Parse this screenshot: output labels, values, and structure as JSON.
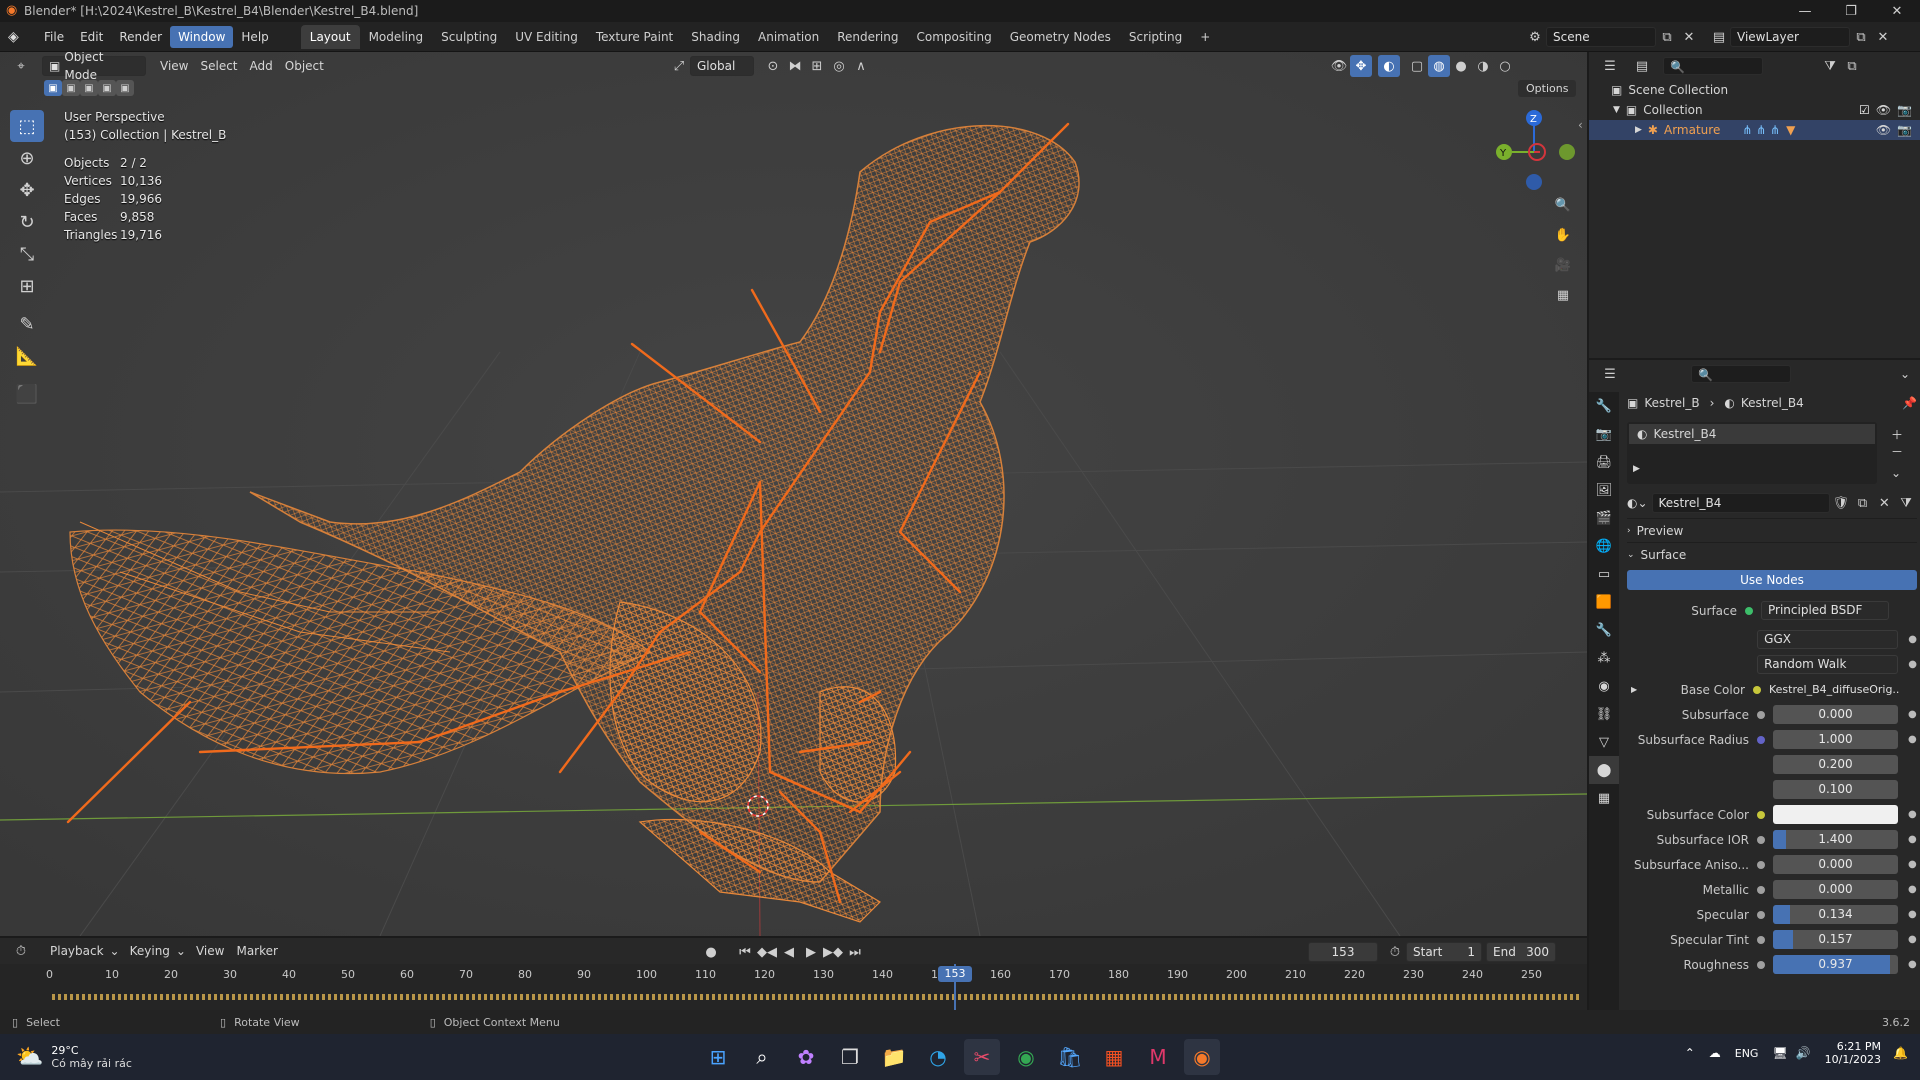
{
  "window": {
    "title": "Blender* [H:\\2024\\Kestrel_B\\Kestrel_B4\\Blender\\Kestrel_B4.blend]",
    "version": "3.6.2"
  },
  "menubar": {
    "menus": [
      "File",
      "Edit",
      "Render",
      "Window",
      "Help"
    ],
    "active_menu": "Window",
    "workspaces": [
      "Layout",
      "Modeling",
      "Sculpting",
      "UV Editing",
      "Texture Paint",
      "Shading",
      "Animation",
      "Rendering",
      "Compositing",
      "Geometry Nodes",
      "Scripting"
    ],
    "active_workspace": "Layout",
    "add_workspace": "+",
    "scene": "Scene",
    "view_layer": "ViewLayer"
  },
  "viewport": {
    "mode": "Object Mode",
    "menus": [
      "View",
      "Select",
      "Add",
      "Object"
    ],
    "orientation": "Global",
    "options_label": "Options",
    "overlay_title": "User Perspective",
    "overlay_subtitle": "(153) Collection | Kestrel_B",
    "stats": [
      {
        "label": "Objects",
        "value": "2 / 2"
      },
      {
        "label": "Vertices",
        "value": "10,136"
      },
      {
        "label": "Edges",
        "value": "19,966"
      },
      {
        "label": "Faces",
        "value": "9,858"
      },
      {
        "label": "Triangles",
        "value": "19,716"
      }
    ],
    "gizmo": {
      "z": "Z",
      "y": "Y"
    }
  },
  "outliner": {
    "scene_collection": "Scene Collection",
    "collection": "Collection",
    "armature": "Armature"
  },
  "properties": {
    "breadcrumb": [
      "Kestrel_B",
      "Kestrel_B4"
    ],
    "material_slot": "Kestrel_B4",
    "material_name": "Kestrel_B4",
    "panels": {
      "preview": "Preview",
      "surface": "Surface"
    },
    "use_nodes": "Use Nodes",
    "surface_label": "Surface",
    "surface_value": "Principled BSDF",
    "distribution": "GGX",
    "subsurface_method": "Random Walk",
    "base_color_label": "Base Color",
    "base_color_value": "Kestrel_B4_diffuseOrig...",
    "fields": [
      {
        "label": "Subsurface",
        "value": "0.000",
        "fill": 0
      },
      {
        "label": "Subsurface Radius",
        "value": "1.000",
        "fill": 0
      },
      {
        "label": "",
        "value": "0.200",
        "fill": 0
      },
      {
        "label": "",
        "value": "0.100",
        "fill": 0
      }
    ],
    "subsurface_color_label": "Subsurface Color",
    "fields2": [
      {
        "label": "Subsurface IOR",
        "value": "1.400",
        "fill": 0.1
      },
      {
        "label": "Subsurface Aniso...",
        "value": "0.000",
        "fill": 0
      },
      {
        "label": "Metallic",
        "value": "0.000",
        "fill": 0
      },
      {
        "label": "Specular",
        "value": "0.134",
        "fill": 0.134
      },
      {
        "label": "Specular Tint",
        "value": "0.157",
        "fill": 0.157
      },
      {
        "label": "Roughness",
        "value": "0.937",
        "fill": 0.937
      }
    ]
  },
  "timeline": {
    "menus": [
      "Playback",
      "Keying",
      "View",
      "Marker"
    ],
    "current_frame": "153",
    "start_label": "Start",
    "start_value": "1",
    "end_label": "End",
    "end_value": "300",
    "ticks": [
      "0",
      "10",
      "20",
      "30",
      "40",
      "50",
      "60",
      "70",
      "80",
      "90",
      "100",
      "110",
      "120",
      "130",
      "140",
      "150",
      "160",
      "170",
      "180",
      "190",
      "200",
      "210",
      "220",
      "230",
      "240",
      "250"
    ],
    "playhead_label": "153"
  },
  "statusbar": {
    "select": "Select",
    "rotate": "Rotate View",
    "context": "Object Context Menu",
    "version": "3.6.2"
  },
  "taskbar": {
    "temp": "29°C",
    "weather": "Có mây rải rác",
    "lang": "ENG",
    "time": "6:21 PM",
    "date": "10/1/2023"
  },
  "colors": {
    "accent": "#4772b3",
    "wire": "#e8883a",
    "bone": "#f06a1c",
    "viewport_bg": "#3d3d3d"
  }
}
